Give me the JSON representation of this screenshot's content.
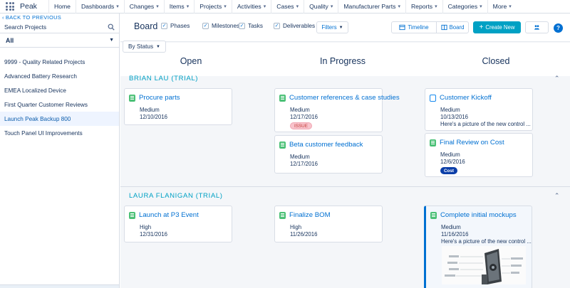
{
  "app": {
    "name": "Peak",
    "icon": "waffle-icon"
  },
  "nav": [
    {
      "label": "Home",
      "dropdown": false
    },
    {
      "label": "Dashboards",
      "dropdown": true
    },
    {
      "label": "Changes",
      "dropdown": true
    },
    {
      "label": "Items",
      "dropdown": true
    },
    {
      "label": "Projects",
      "dropdown": true
    },
    {
      "label": "Activities",
      "dropdown": true
    },
    {
      "label": "Cases",
      "dropdown": true
    },
    {
      "label": "Quality",
      "dropdown": true
    },
    {
      "label": "Manufacturer Parts",
      "dropdown": true
    },
    {
      "label": "Reports",
      "dropdown": true
    },
    {
      "label": "Categories",
      "dropdown": true
    },
    {
      "label": "More",
      "dropdown": true
    }
  ],
  "sidebar": {
    "back_label": "BACK TO PREVIOUS",
    "search_placeholder": "Search Projects",
    "filter_label": "All",
    "projects": [
      "9999 - Quality Related Projects",
      "Advanced Battery Research",
      "EMEA Localized Device",
      "First Quarter Customer Reviews",
      "Launch Peak Backup 800",
      "Touch Panel UI Improvements"
    ],
    "selected_project": "Launch Peak Backup 800"
  },
  "toolbar": {
    "title": "Board",
    "checkboxes": [
      {
        "label": "Phases",
        "checked": true
      },
      {
        "label": "Milestones",
        "checked": true
      },
      {
        "label": "Tasks",
        "checked": true
      },
      {
        "label": "Deliverables",
        "checked": true
      }
    ],
    "filters_label": "Filters",
    "timeline_label": "Timeline",
    "board_label": "Board",
    "create_label": "Create New",
    "help_label": "?"
  },
  "board": {
    "group_by_label": "By Status",
    "columns": [
      "Open",
      "In Progress",
      "Closed"
    ],
    "groups": [
      {
        "name": "BRIAN LAU (TRIAL)",
        "cards": [
          {
            "column": "Open",
            "type": "task",
            "title": "Procure parts",
            "priority": "Medium",
            "date": "12/10/2016"
          },
          {
            "column": "In Progress",
            "type": "task",
            "title": "Customer references & case studies",
            "priority": "Medium",
            "date": "12/17/2016",
            "badge": "ISSUE"
          },
          {
            "column": "In Progress",
            "type": "task",
            "title": "Beta customer feedback",
            "priority": "Medium",
            "date": "12/17/2016"
          },
          {
            "column": "Closed",
            "type": "milestone",
            "title": "Customer Kickoff",
            "priority": "Medium",
            "date": "10/13/2016",
            "note": "Here's a picture of the new control ..."
          },
          {
            "column": "Closed",
            "type": "task",
            "title": "Final Review on Cost",
            "priority": "Medium",
            "date": "12/6/2016",
            "badge": "Cost"
          }
        ]
      },
      {
        "name": "LAURA FLANIGAN (TRIAL)",
        "cards": [
          {
            "column": "Open",
            "type": "task",
            "title": "Launch at P3 Event",
            "priority": "High",
            "date": "12/31/2016"
          },
          {
            "column": "In Progress",
            "type": "task",
            "title": "Finalize BOM",
            "priority": "High",
            "date": "11/26/2016"
          },
          {
            "column": "Closed",
            "type": "task",
            "title": "Complete initial mockups",
            "priority": "Medium",
            "date": "11/16/2016",
            "note": "Here's a picture of the new control ...",
            "has_image": true
          }
        ]
      }
    ]
  },
  "colors": {
    "accent": "#00a1c4",
    "link": "#0070d2",
    "text": "#16325c",
    "task_icon": "#4bc076"
  }
}
